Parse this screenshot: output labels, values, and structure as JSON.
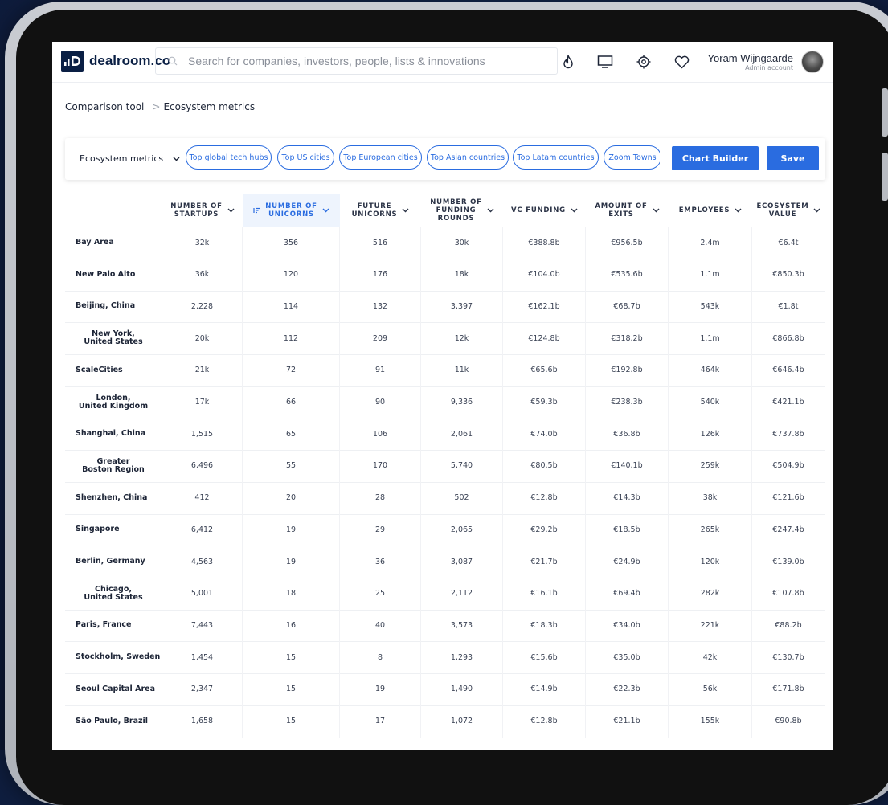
{
  "header": {
    "logo_text": "dealroom.co",
    "search_placeholder": "Search for companies, investors, people, lists & innovations",
    "user_name": "Yoram Wijngaarde",
    "user_role": "Admin account"
  },
  "breadcrumb": {
    "root": "Comparison tool",
    "current": "Ecosystem metrics"
  },
  "toolbar": {
    "select_label": "Ecosystem metrics",
    "chips": [
      "Top global tech hubs",
      "Top US cities",
      "Top European cities",
      "Top Asian countries",
      "Top Latam countries",
      "Zoom Towns"
    ],
    "chart_builder_label": "Chart Builder",
    "save_label": "Save"
  },
  "table": {
    "columns": [
      {
        "label": "NUMBER OF\nSTARTUPS"
      },
      {
        "label": "NUMBER OF\nUNICORNS",
        "active": true
      },
      {
        "label": "FUTURE\nUNICORNS"
      },
      {
        "label": "NUMBER OF\nFUNDING\nROUNDS"
      },
      {
        "label": "VC FUNDING"
      },
      {
        "label": "AMOUNT OF\nEXITS"
      },
      {
        "label": "EMPLOYEES"
      },
      {
        "label": "ECOSYSTEM\nVALUE"
      }
    ],
    "rows": [
      {
        "name": "Bay Area",
        "values": [
          "32k",
          "356",
          "516",
          "30k",
          "€388.8b",
          "€956.5b",
          "2.4m",
          "€6.4t"
        ]
      },
      {
        "name": "New Palo Alto",
        "values": [
          "36k",
          "120",
          "176",
          "18k",
          "€104.0b",
          "€535.6b",
          "1.1m",
          "€850.3b"
        ]
      },
      {
        "name": "Beijing, China",
        "values": [
          "2,228",
          "114",
          "132",
          "3,397",
          "€162.1b",
          "€68.7b",
          "543k",
          "€1.8t"
        ]
      },
      {
        "name": "New York,\nUnited States",
        "centered": true,
        "values": [
          "20k",
          "112",
          "209",
          "12k",
          "€124.8b",
          "€318.2b",
          "1.1m",
          "€866.8b"
        ]
      },
      {
        "name": "ScaleCities",
        "values": [
          "21k",
          "72",
          "91",
          "11k",
          "€65.6b",
          "€192.8b",
          "464k",
          "€646.4b"
        ]
      },
      {
        "name": "London,\nUnited Kingdom",
        "centered": true,
        "values": [
          "17k",
          "66",
          "90",
          "9,336",
          "€59.3b",
          "€238.3b",
          "540k",
          "€421.1b"
        ]
      },
      {
        "name": "Shanghai, China",
        "values": [
          "1,515",
          "65",
          "106",
          "2,061",
          "€74.0b",
          "€36.8b",
          "126k",
          "€737.8b"
        ]
      },
      {
        "name": "Greater\nBoston Region",
        "centered": true,
        "values": [
          "6,496",
          "55",
          "170",
          "5,740",
          "€80.5b",
          "€140.1b",
          "259k",
          "€504.9b"
        ]
      },
      {
        "name": "Shenzhen, China",
        "values": [
          "412",
          "20",
          "28",
          "502",
          "€12.8b",
          "€14.3b",
          "38k",
          "€121.6b"
        ]
      },
      {
        "name": "Singapore",
        "values": [
          "6,412",
          "19",
          "29",
          "2,065",
          "€29.2b",
          "€18.5b",
          "265k",
          "€247.4b"
        ]
      },
      {
        "name": "Berlin, Germany",
        "values": [
          "4,563",
          "19",
          "36",
          "3,087",
          "€21.7b",
          "€24.9b",
          "120k",
          "€139.0b"
        ]
      },
      {
        "name": "Chicago,\nUnited States",
        "centered": true,
        "values": [
          "5,001",
          "18",
          "25",
          "2,112",
          "€16.1b",
          "€69.4b",
          "282k",
          "€107.8b"
        ]
      },
      {
        "name": "Paris, France",
        "values": [
          "7,443",
          "16",
          "40",
          "3,573",
          "€18.3b",
          "€34.0b",
          "221k",
          "€88.2b"
        ]
      },
      {
        "name": "Stockholm, Sweden",
        "values": [
          "1,454",
          "15",
          "8",
          "1,293",
          "€15.6b",
          "€35.0b",
          "42k",
          "€130.7b"
        ]
      },
      {
        "name": "Seoul Capital Area",
        "values": [
          "2,347",
          "15",
          "19",
          "1,490",
          "€14.9b",
          "€22.3b",
          "56k",
          "€171.8b"
        ]
      },
      {
        "name": "São Paulo, Brazil",
        "values": [
          "1,658",
          "15",
          "17",
          "1,072",
          "€12.8b",
          "€21.1b",
          "155k",
          "€90.8b"
        ]
      }
    ]
  },
  "colors": {
    "accent": "#2a6ce0",
    "brand": "#0a1f44",
    "active_column_bg": "#eef4fd"
  }
}
